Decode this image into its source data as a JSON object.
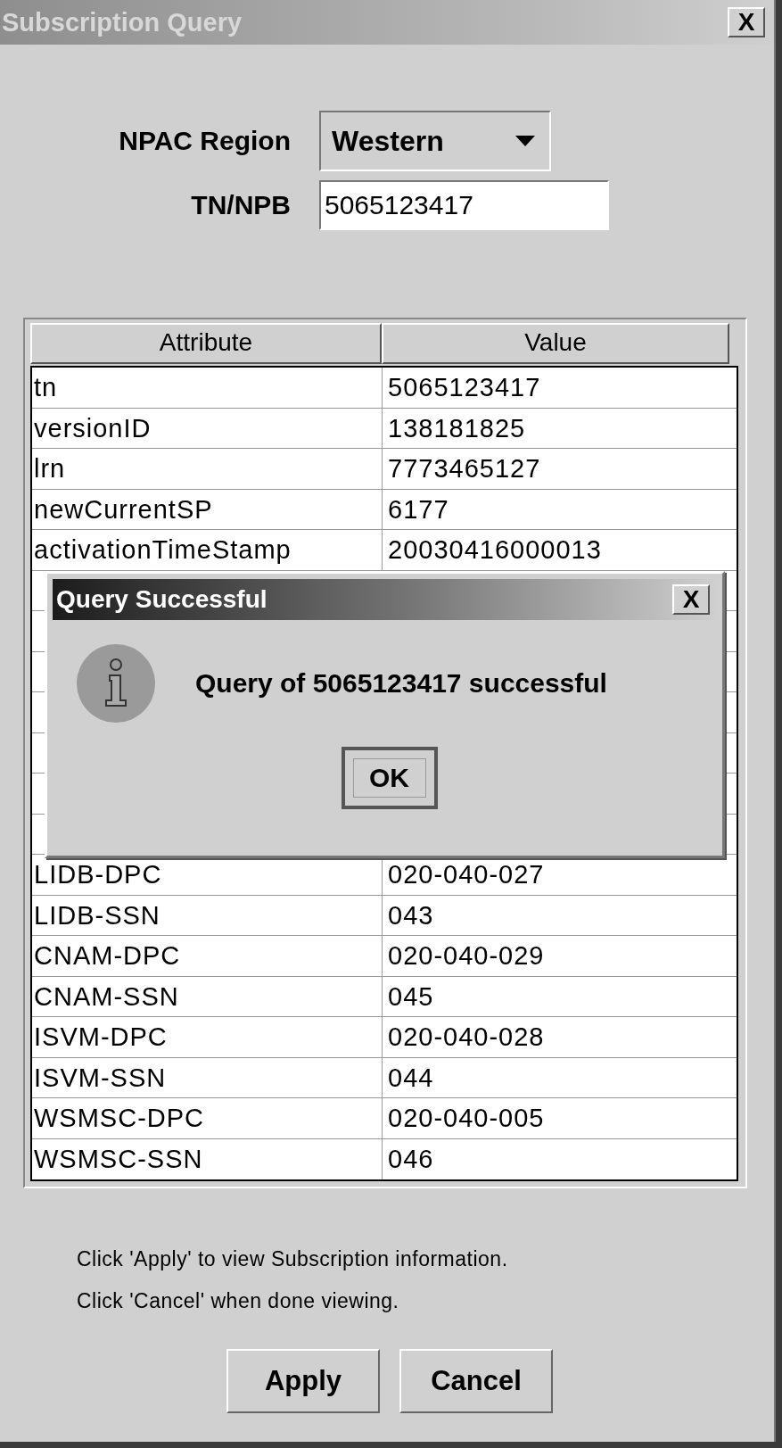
{
  "window": {
    "title": "Subscription Query",
    "close": "X"
  },
  "form": {
    "region_label": "NPAC Region",
    "region_value": "Western",
    "tn_label": "TN/NPB",
    "tn_value": "5065123417"
  },
  "table": {
    "columns": [
      "Attribute",
      "Value"
    ],
    "rows_above": [
      {
        "attribute": "tn",
        "value": "5065123417"
      },
      {
        "attribute": "versionID",
        "value": "138181825"
      },
      {
        "attribute": "lrn",
        "value": "7773465127"
      },
      {
        "attribute": "newCurrentSP",
        "value": "6177"
      },
      {
        "attribute": "activationTimeStamp",
        "value": "20030416000013"
      }
    ],
    "rows_below": [
      {
        "attribute": "LIDB-DPC",
        "value": "020-040-027"
      },
      {
        "attribute": "LIDB-SSN",
        "value": "043"
      },
      {
        "attribute": "CNAM-DPC",
        "value": "020-040-029"
      },
      {
        "attribute": "CNAM-SSN",
        "value": "045"
      },
      {
        "attribute": "ISVM-DPC",
        "value": "020-040-028"
      },
      {
        "attribute": "ISVM-SSN",
        "value": "044"
      },
      {
        "attribute": "WSMSC-DPC",
        "value": "020-040-005"
      },
      {
        "attribute": "WSMSC-SSN",
        "value": "046"
      }
    ]
  },
  "hints": [
    "Click 'Apply' to view Subscription information.",
    "Click 'Cancel' when done viewing."
  ],
  "buttons": [
    "Apply",
    "Cancel"
  ],
  "dialog": {
    "title": "Query Successful",
    "close": "X",
    "message": "Query of 5065123417 successful",
    "button": "OK"
  }
}
